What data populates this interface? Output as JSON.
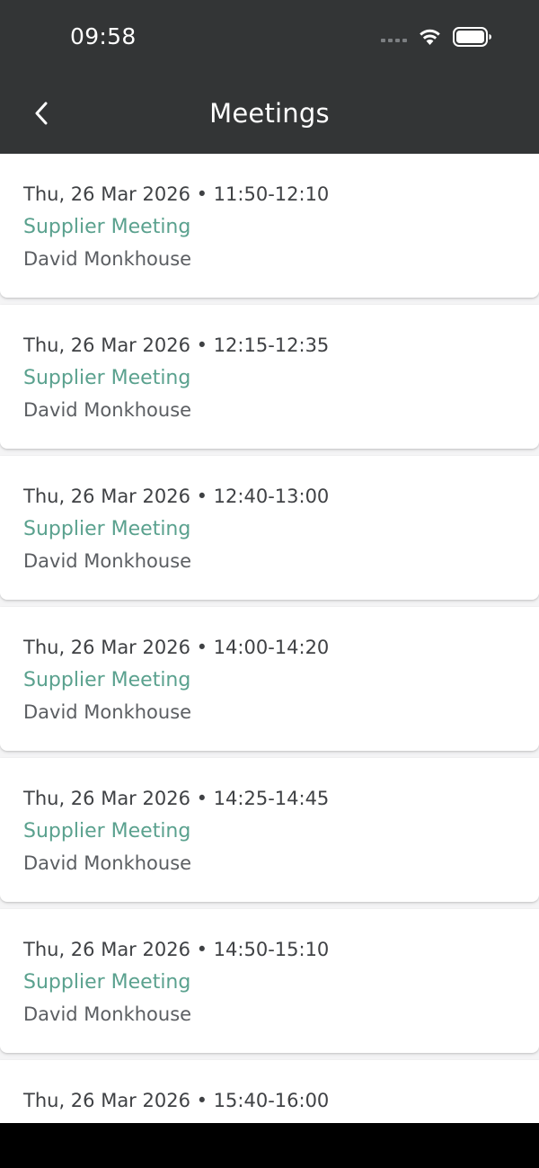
{
  "status_bar": {
    "time": "09:58",
    "icons": [
      "signal-icon",
      "wifi-icon",
      "battery-icon"
    ]
  },
  "header": {
    "title": "Meetings",
    "back_icon": "chevron-left-icon"
  },
  "colors": {
    "header_bg": "#333536",
    "accent": "#5aa18e",
    "date_text": "#3f4144",
    "person_text": "#5b5e62",
    "page_bg": "#f4f4f5"
  },
  "meetings": [
    {
      "when": "Thu, 26 Mar 2026 • 11:50-12:10",
      "type": "Supplier Meeting",
      "person": "David Monkhouse"
    },
    {
      "when": "Thu, 26 Mar 2026 • 12:15-12:35",
      "type": "Supplier Meeting",
      "person": "David Monkhouse"
    },
    {
      "when": "Thu, 26 Mar 2026 • 12:40-13:00",
      "type": "Supplier Meeting",
      "person": "David Monkhouse"
    },
    {
      "when": "Thu, 26 Mar 2026 • 14:00-14:20",
      "type": "Supplier Meeting",
      "person": "David Monkhouse"
    },
    {
      "when": "Thu, 26 Mar 2026 • 14:25-14:45",
      "type": "Supplier Meeting",
      "person": "David Monkhouse"
    },
    {
      "when": "Thu, 26 Mar 2026 • 14:50-15:10",
      "type": "Supplier Meeting",
      "person": "David Monkhouse"
    },
    {
      "when": "Thu, 26 Mar 2026 • 15:40-16:00"
    }
  ]
}
